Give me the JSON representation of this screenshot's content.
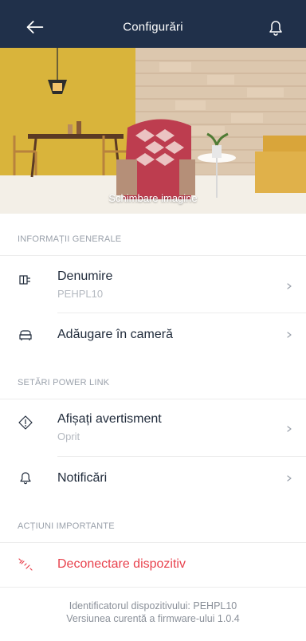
{
  "header": {
    "title": "Configurări",
    "back_icon": "arrow-left-icon",
    "notification_icon": "bell-icon",
    "background_color": "#20304a"
  },
  "hero": {
    "caption": "Schimbare imagine"
  },
  "sections": {
    "general": {
      "title": "INFORMAȚII GENERALE",
      "items": [
        {
          "label": "Denumire",
          "value": "PEHPL10",
          "icon": "device-icon"
        },
        {
          "label": "Adăugare în cameră",
          "icon": "sofa-icon"
        }
      ]
    },
    "power_link": {
      "title": "SETĂRI POWER LINK",
      "items": [
        {
          "label": "Afișați avertisment",
          "value": "Oprit",
          "icon": "warning-icon"
        },
        {
          "label": "Notificări",
          "icon": "bell-icon"
        }
      ]
    },
    "actions": {
      "title": "ACȚIUNI IMPORTANTE",
      "items": [
        {
          "label": "Deconectare dispozitiv",
          "icon": "disconnect-icon",
          "color": "#e8424d"
        }
      ]
    }
  },
  "footer": {
    "device_id": "Identificatorul dispozitivului: PEHPL10",
    "firmware": "Versiunea curentă a firmware-ului 1.0.4"
  }
}
